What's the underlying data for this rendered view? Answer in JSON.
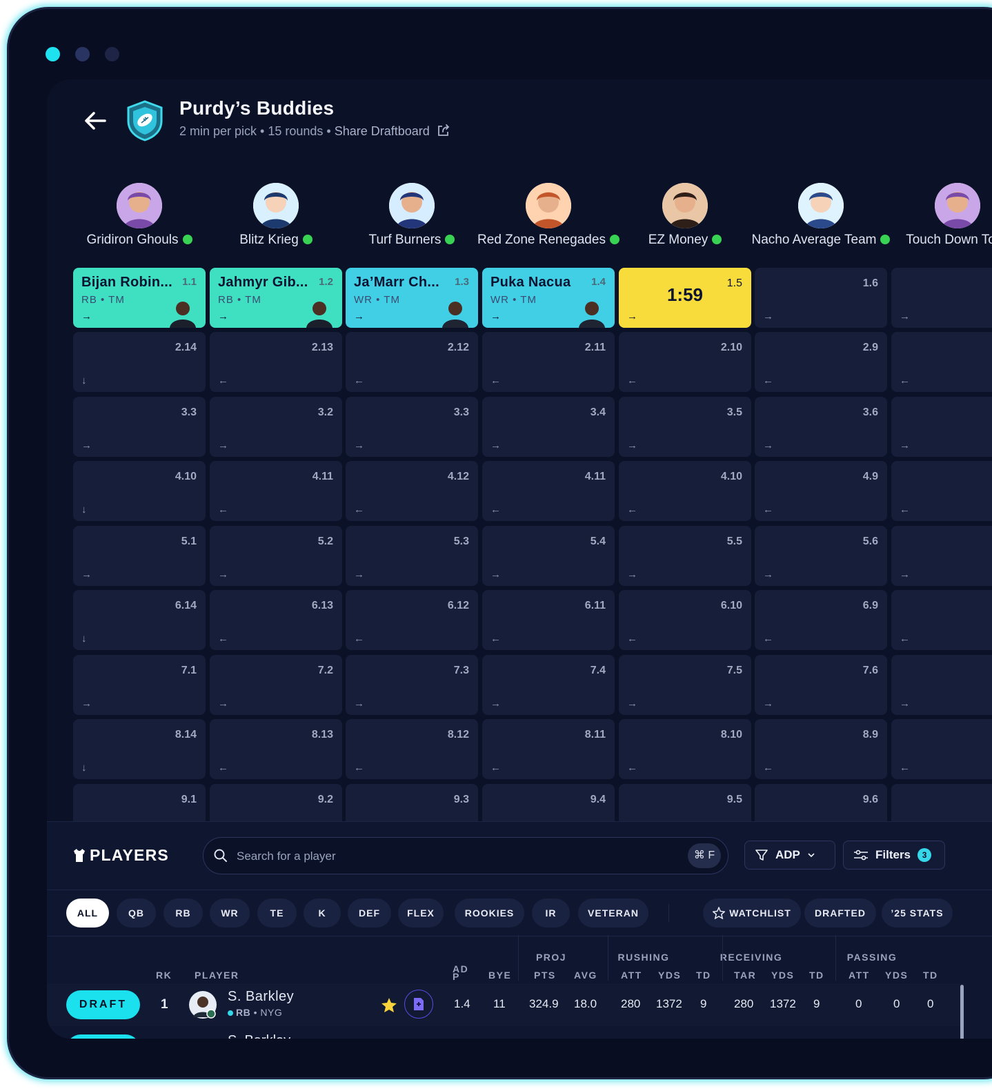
{
  "window": {
    "controls": [
      {
        "name": "close",
        "color": "#1fe2f0"
      },
      {
        "name": "minimize",
        "color": "#2a3462"
      },
      {
        "name": "maximize",
        "color": "#1d2446"
      }
    ]
  },
  "league": {
    "name": "Purdy’s Buddies",
    "meta": "2 min per pick • 15 rounds • ",
    "share_label": "Share Draftboard"
  },
  "teams": [
    {
      "name": "Gridiron Ghouls",
      "status": "online"
    },
    {
      "name": "Blitz Krieg",
      "status": "online"
    },
    {
      "name": "Turf Burners",
      "status": "online"
    },
    {
      "name": "Red Zone Renegades",
      "status": "online"
    },
    {
      "name": "EZ Money",
      "status": "online"
    },
    {
      "name": "Nacho Average Team",
      "status": "online"
    },
    {
      "name": "Touch Down To",
      "status": "online"
    }
  ],
  "board": {
    "rows": [
      [
        {
          "type": "pick",
          "player": "Bijan Robin...",
          "pos": "RB • TM",
          "pick": "1.1",
          "dir": "→",
          "color": "#3ee0c1"
        },
        {
          "type": "pick",
          "player": "Jahmyr Gib...",
          "pos": "RB • TM",
          "pick": "1.2",
          "dir": "→",
          "color": "#3ee0c1"
        },
        {
          "type": "pick",
          "player": "Ja’Marr Ch...",
          "pos": "WR • TM",
          "pick": "1.3",
          "dir": "→",
          "color": "#41cfe6"
        },
        {
          "type": "pick",
          "player": "Puka Nacua",
          "pos": "WR • TM",
          "pick": "1.4",
          "dir": "→",
          "color": "#41cfe6"
        },
        {
          "type": "current",
          "timer": "1:59",
          "pick": "1.5",
          "dir": "→"
        },
        {
          "type": "empty",
          "pick": "1.6",
          "dir": "→"
        },
        {
          "type": "empty",
          "pick": "",
          "dir": "→"
        }
      ],
      [
        {
          "pick": "2.14",
          "dir": "↓"
        },
        {
          "pick": "2.13",
          "dir": "←"
        },
        {
          "pick": "2.12",
          "dir": "←"
        },
        {
          "pick": "2.11",
          "dir": "←"
        },
        {
          "pick": "2.10",
          "dir": "←"
        },
        {
          "pick": "2.9",
          "dir": "←"
        },
        {
          "pick": "",
          "dir": "←"
        }
      ],
      [
        {
          "pick": "3.3",
          "dir": "→"
        },
        {
          "pick": "3.2",
          "dir": "→"
        },
        {
          "pick": "3.3",
          "dir": "→"
        },
        {
          "pick": "3.4",
          "dir": "→"
        },
        {
          "pick": "3.5",
          "dir": "→"
        },
        {
          "pick": "3.6",
          "dir": "→"
        },
        {
          "pick": "",
          "dir": "→"
        }
      ],
      [
        {
          "pick": "4.10",
          "dir": "↓"
        },
        {
          "pick": "4.11",
          "dir": "←"
        },
        {
          "pick": "4.12",
          "dir": "←"
        },
        {
          "pick": "4.11",
          "dir": "←"
        },
        {
          "pick": "4.10",
          "dir": "←"
        },
        {
          "pick": "4.9",
          "dir": "←"
        },
        {
          "pick": "",
          "dir": "←"
        }
      ],
      [
        {
          "pick": "5.1",
          "dir": "→"
        },
        {
          "pick": "5.2",
          "dir": "→"
        },
        {
          "pick": "5.3",
          "dir": "→"
        },
        {
          "pick": "5.4",
          "dir": "→"
        },
        {
          "pick": "5.5",
          "dir": "→"
        },
        {
          "pick": "5.6",
          "dir": "→"
        },
        {
          "pick": "",
          "dir": "→"
        }
      ],
      [
        {
          "pick": "6.14",
          "dir": "↓"
        },
        {
          "pick": "6.13",
          "dir": "←"
        },
        {
          "pick": "6.12",
          "dir": "←"
        },
        {
          "pick": "6.11",
          "dir": "←"
        },
        {
          "pick": "6.10",
          "dir": "←"
        },
        {
          "pick": "6.9",
          "dir": "←"
        },
        {
          "pick": "",
          "dir": "←"
        }
      ],
      [
        {
          "pick": "7.1",
          "dir": "→"
        },
        {
          "pick": "7.2",
          "dir": "→"
        },
        {
          "pick": "7.3",
          "dir": "→"
        },
        {
          "pick": "7.4",
          "dir": "→"
        },
        {
          "pick": "7.5",
          "dir": "→"
        },
        {
          "pick": "7.6",
          "dir": "→"
        },
        {
          "pick": "",
          "dir": "→"
        }
      ],
      [
        {
          "pick": "8.14",
          "dir": "↓"
        },
        {
          "pick": "8.13",
          "dir": "←"
        },
        {
          "pick": "8.12",
          "dir": "←"
        },
        {
          "pick": "8.11",
          "dir": "←"
        },
        {
          "pick": "8.10",
          "dir": "←"
        },
        {
          "pick": "8.9",
          "dir": "←"
        },
        {
          "pick": "",
          "dir": "←"
        }
      ],
      [
        {
          "pick": "9.1",
          "dir": ""
        },
        {
          "pick": "9.2",
          "dir": ""
        },
        {
          "pick": "9.3",
          "dir": ""
        },
        {
          "pick": "9.4",
          "dir": ""
        },
        {
          "pick": "9.5",
          "dir": ""
        },
        {
          "pick": "9.6",
          "dir": ""
        },
        {
          "pick": "",
          "dir": ""
        }
      ]
    ]
  },
  "players_panel": {
    "title": "PLAYERS",
    "search_placeholder": "Search for a player",
    "search_shortcut": "⌘ F",
    "sort_label": "ADP",
    "filters_label": "Filters",
    "filters_count": "3",
    "positions": [
      "ALL",
      "QB",
      "RB",
      "WR",
      "TE",
      "K",
      "DEF",
      "FLEX",
      "ROOKIES",
      "IR",
      "VETERAN"
    ],
    "active_position": "ALL",
    "views": [
      "WATCHLIST",
      "DRAFTED",
      "’25 STATS"
    ],
    "groups": [
      "PROJ",
      "RUSHING",
      "RECEIVING",
      "PASSING"
    ],
    "columns": [
      "RK",
      "PLAYER",
      "ADP",
      "BYE",
      "PTS",
      "AVG",
      "ATT",
      "YDS",
      "TD",
      "TAR",
      "YDS",
      "TD",
      "ATT",
      "YDS",
      "TD"
    ],
    "rows": [
      {
        "action": "DRAFT",
        "rank": "1",
        "name": "S. Barkley",
        "position": "RB",
        "team": "NYG",
        "adp": "1.4",
        "bye": "11",
        "pts": "324.9",
        "avg": "18.0",
        "rush_att": "280",
        "rush_yds": "1372",
        "rush_td": "9",
        "rec_tar": "280",
        "rec_yds": "1372",
        "rec_td": "9",
        "pass_att": "0",
        "pass_yds": "0",
        "pass_td": "0",
        "watchlisted": true
      },
      {
        "action": "DRAFT",
        "rank": "",
        "name": "S. Barkley"
      }
    ]
  }
}
